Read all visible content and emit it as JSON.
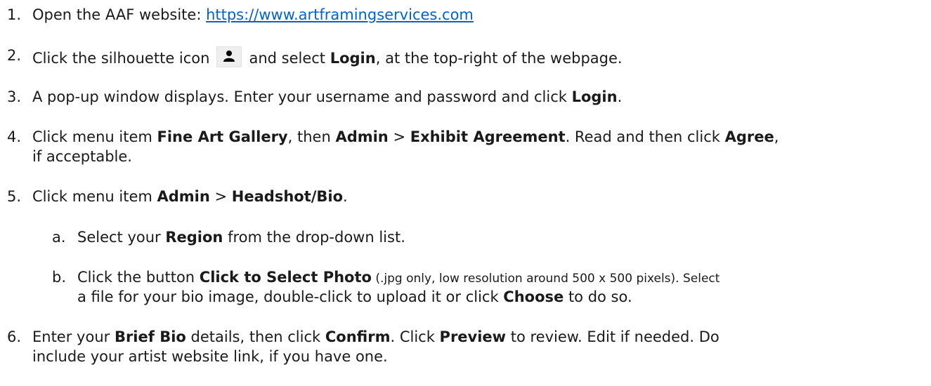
{
  "steps": [
    {
      "num": "1.",
      "parts": [
        "Open the AAF website: ",
        "https://www.artframingservices.com"
      ]
    },
    {
      "num": "2.",
      "parts": [
        "Click the silhouette icon",
        "and select ",
        "Login",
        ", at the top-right of the webpage."
      ],
      "icon": "user-silhouette-icon"
    },
    {
      "num": "3.",
      "parts": [
        "A pop-up window displays. Enter your username and password and click ",
        "Login",
        "."
      ]
    },
    {
      "num": "4.",
      "parts": [
        "Click menu item ",
        "Fine Art Gallery",
        ", then ",
        "Admin",
        " > ",
        "Exhibit Agreement",
        ". Read and then click ",
        "Agree",
        ","
      ],
      "cont": "if acceptable."
    },
    {
      "num": "5.",
      "parts": [
        "Click menu item ",
        "Admin",
        " > ",
        "Headshot/Bio",
        "."
      ]
    },
    {
      "num": "a.",
      "parts": [
        "Select your ",
        "Region",
        " from the drop-down list."
      ]
    },
    {
      "num": "b.",
      "parts": [
        "Click the button ",
        "Click to Select Photo",
        " (.jpg only, low resolution around 500 x 500 pixels). Select"
      ],
      "cont": "a file for your bio image, double-click to upload it or click ",
      "cont_bold": "Choose",
      "cont_end": " to do so."
    },
    {
      "num": "6.",
      "parts": [
        "Enter your ",
        "Brief Bio",
        " details, then click ",
        "Confirm",
        ". Click ",
        "Preview",
        " to review. Edit if needed. Do"
      ],
      "cont": "include your artist website link, if you have one."
    }
  ],
  "icon_color": "#000000"
}
